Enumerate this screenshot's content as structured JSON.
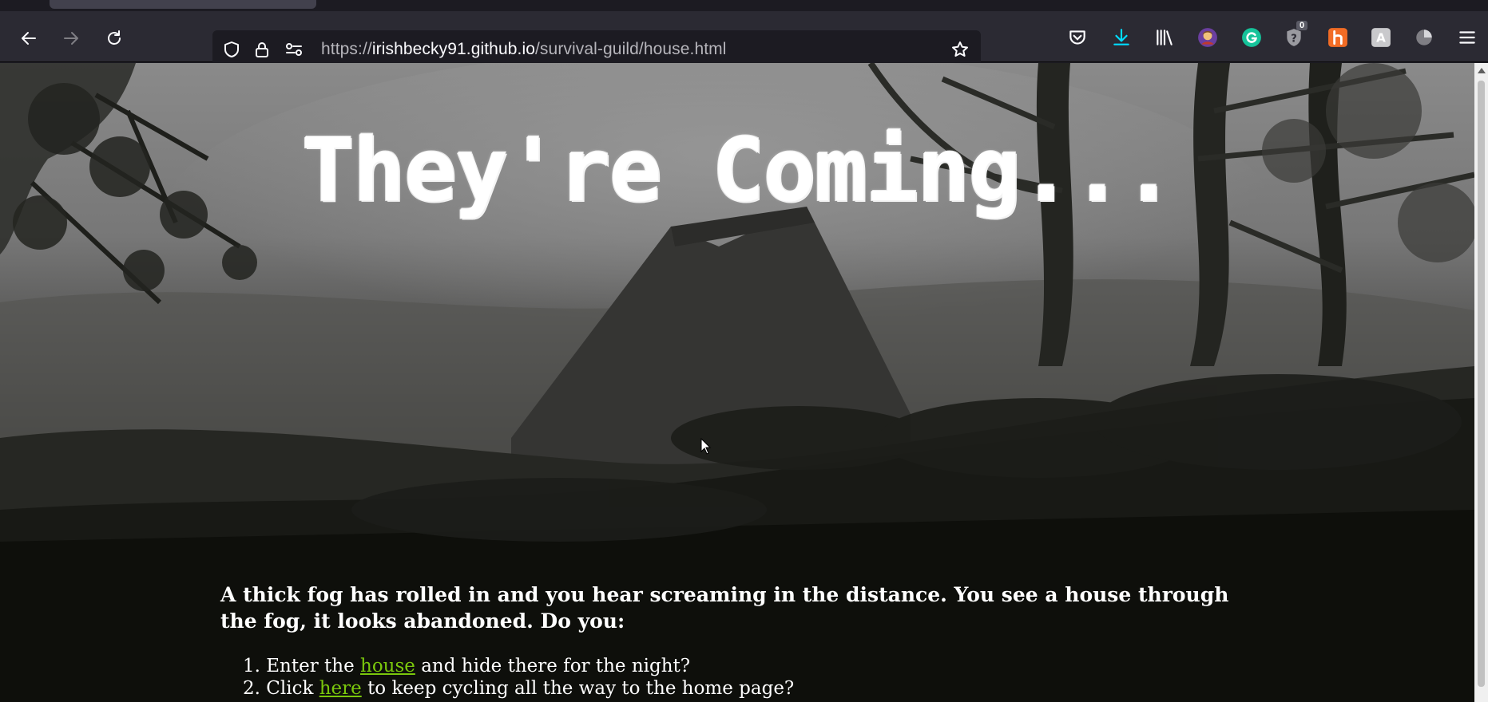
{
  "browser": {
    "url_prefix": "https://",
    "url_host": "irishbecky91.github.io",
    "url_path": "/survival-guild/house.html",
    "toolbar_icons": [
      "pocket-icon",
      "downloads-icon",
      "library-icon",
      "profile-avatar-icon",
      "grammarly-icon",
      "privacy-badger-icon",
      "honey-icon",
      "translate-icon",
      "pie-chart-icon",
      "menu-icon"
    ],
    "badge_count": "0"
  },
  "page": {
    "title": "They're Coming...",
    "story": "A thick fog has rolled in and you hear screaming in the distance. You see a house through the fog, it looks abandoned. Do you:",
    "choices": [
      {
        "number": "1.",
        "before": "Enter the",
        "link": "house",
        "after": "and hide there for the night?"
      },
      {
        "number": "2.",
        "before": "Click",
        "link": "here",
        "after": "to keep cycling all the way to the home page?"
      }
    ]
  },
  "colors": {
    "chrome_bg": "#2b2a33",
    "url_bg": "#1c1b22",
    "page_bg": "#0e0f0b",
    "link": "#7ac70c",
    "text": "#ffffff"
  }
}
